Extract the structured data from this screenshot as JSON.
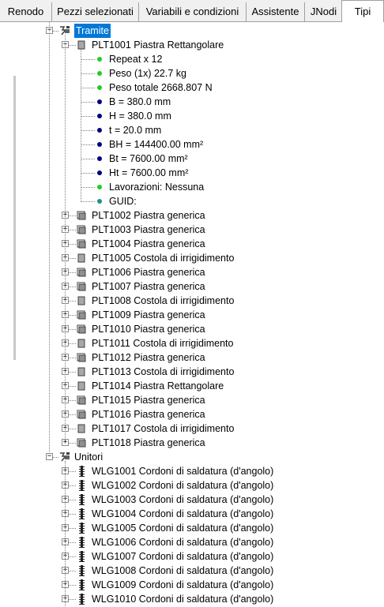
{
  "tabs": [
    {
      "label": "Renodo",
      "active": false
    },
    {
      "label": "Pezzi selezionati",
      "active": false
    },
    {
      "label": "Variabili e condizioni",
      "active": false
    },
    {
      "label": "Assistente",
      "active": false
    },
    {
      "label": "JNodi",
      "active": false
    },
    {
      "label": "Tipi",
      "active": true
    }
  ],
  "tree": {
    "tramite": {
      "label": "Tramite",
      "selected": true,
      "expanded_item": {
        "label": "PLT1001 Piastra Rettangolare",
        "properties": [
          {
            "label": "Repeat x 12",
            "color": "green"
          },
          {
            "label": "Peso (1x)    22.7 kg",
            "color": "green"
          },
          {
            "label": "Peso totale 2668.807    N",
            "color": "green"
          },
          {
            "label": "B = 380.0 mm",
            "color": "navy"
          },
          {
            "label": "H = 380.0 mm",
            "color": "navy"
          },
          {
            "label": "t =  20.0 mm",
            "color": "navy"
          },
          {
            "label": "BH = 144400.00 mm²",
            "color": "navy"
          },
          {
            "label": "Bt =  7600.00 mm²",
            "color": "navy"
          },
          {
            "label": "Ht =  7600.00 mm²",
            "color": "navy"
          },
          {
            "label": "Lavorazioni: Nessuna",
            "color": "green"
          },
          {
            "label": "GUID:",
            "color": "teal"
          }
        ]
      },
      "items": [
        {
          "label": "PLT1002 Piastra generica",
          "icon": "generic-plate"
        },
        {
          "label": "PLT1003 Piastra generica",
          "icon": "generic-plate"
        },
        {
          "label": "PLT1004 Piastra generica",
          "icon": "generic-plate"
        },
        {
          "label": "PLT1005 Costola di irrigidimento",
          "icon": "rect-plate"
        },
        {
          "label": "PLT1006 Piastra generica",
          "icon": "generic-plate"
        },
        {
          "label": "PLT1007 Piastra generica",
          "icon": "generic-plate"
        },
        {
          "label": "PLT1008 Costola di irrigidimento",
          "icon": "rect-plate"
        },
        {
          "label": "PLT1009 Piastra generica",
          "icon": "generic-plate"
        },
        {
          "label": "PLT1010 Piastra generica",
          "icon": "generic-plate"
        },
        {
          "label": "PLT1011 Costola di irrigidimento",
          "icon": "rect-plate"
        },
        {
          "label": "PLT1012 Piastra generica",
          "icon": "generic-plate"
        },
        {
          "label": "PLT1013 Costola di irrigidimento",
          "icon": "rect-plate"
        },
        {
          "label": "PLT1014 Piastra Rettangolare",
          "icon": "rect-plate"
        },
        {
          "label": "PLT1015 Piastra generica",
          "icon": "generic-plate"
        },
        {
          "label": "PLT1016 Piastra generica",
          "icon": "generic-plate"
        },
        {
          "label": "PLT1017 Costola di irrigidimento",
          "icon": "rect-plate"
        },
        {
          "label": "PLT1018 Piastra generica",
          "icon": "generic-plate"
        }
      ]
    },
    "unitori": {
      "label": "Unitori",
      "items": [
        {
          "label": "WLG1001 Cordoni di saldatura (d'angolo)"
        },
        {
          "label": "WLG1002 Cordoni di saldatura (d'angolo)"
        },
        {
          "label": "WLG1003 Cordoni di saldatura (d'angolo)"
        },
        {
          "label": "WLG1004 Cordoni di saldatura (d'angolo)"
        },
        {
          "label": "WLG1005 Cordoni di saldatura (d'angolo)"
        },
        {
          "label": "WLG1006 Cordoni di saldatura (d'angolo)"
        },
        {
          "label": "WLG1007 Cordoni di saldatura (d'angolo)"
        },
        {
          "label": "WLG1008 Cordoni di saldatura (d'angolo)"
        },
        {
          "label": "WLG1009 Cordoni di saldatura (d'angolo)"
        },
        {
          "label": "WLG1010 Cordoni di saldatura (d'angolo)"
        }
      ]
    }
  },
  "colors": {
    "selection": "#0078d7",
    "dot_green": "#22cc22",
    "dot_navy": "#000080",
    "dot_teal": "#1f8f8f",
    "tree_line": "#808080"
  }
}
